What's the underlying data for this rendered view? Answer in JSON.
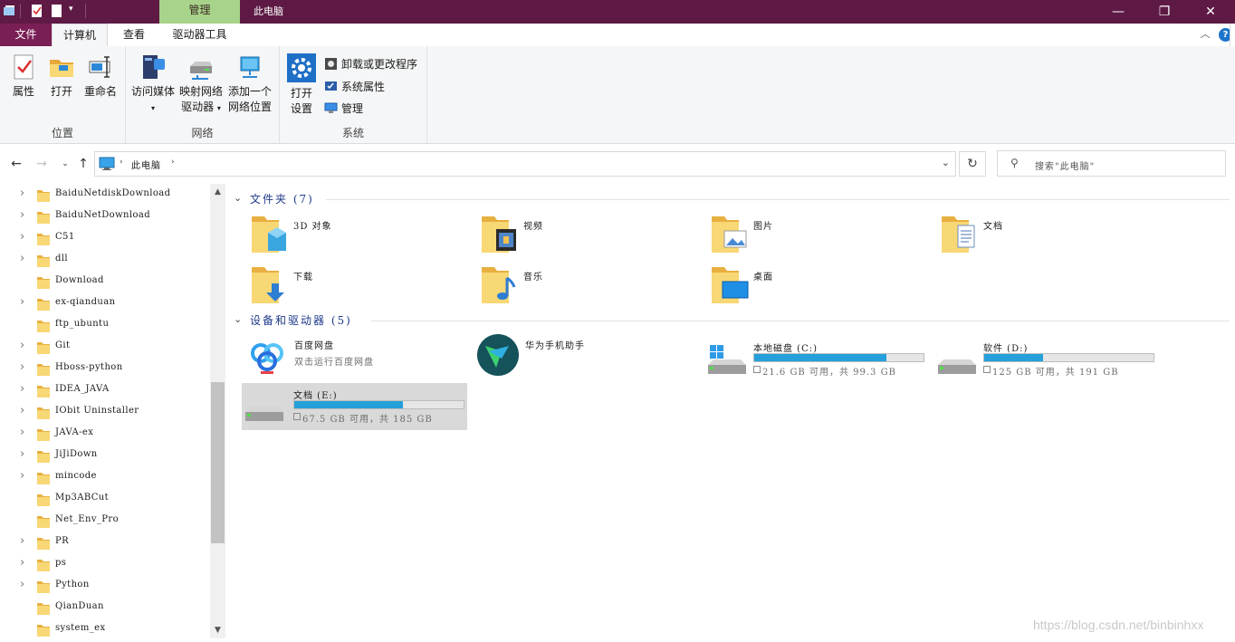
{
  "window": {
    "title": "此电脑",
    "context_tab": "管理",
    "controls": [
      "—",
      "❐",
      "✕"
    ]
  },
  "ribbon_tabs": {
    "file": "文件",
    "computer": "计算机",
    "view": "查看",
    "drive_tools": "驱动器工具"
  },
  "ribbon": {
    "location": {
      "label": "位置",
      "properties": "属性",
      "open": "打开",
      "rename": "重命名"
    },
    "network": {
      "label": "网络",
      "access_media": "访问媒体",
      "map_drive_l1": "映射网络",
      "map_drive_l2": "驱动器",
      "add_location_l1": "添加一个",
      "add_location_l2": "网络位置"
    },
    "system": {
      "label": "系统",
      "open_settings_l1": "打开",
      "open_settings_l2": "设置",
      "uninstall": "卸载或更改程序",
      "system_properties": "系统属性",
      "manage": "管理"
    }
  },
  "address": {
    "crumb": "此电脑",
    "search_placeholder": "搜索\"此电脑\""
  },
  "nav_tree": [
    {
      "label": "BaiduNetdiskDownload",
      "expandable": true
    },
    {
      "label": "BaiduNetDownload",
      "expandable": true
    },
    {
      "label": "C51",
      "expandable": true
    },
    {
      "label": "dll",
      "expandable": true
    },
    {
      "label": "Download",
      "expandable": false
    },
    {
      "label": "ex-qianduan",
      "expandable": true
    },
    {
      "label": "ftp_ubuntu",
      "expandable": false
    },
    {
      "label": "Git",
      "expandable": true
    },
    {
      "label": "Hboss-python",
      "expandable": true
    },
    {
      "label": "IDEA_JAVA",
      "expandable": true
    },
    {
      "label": "IObit Uninstaller",
      "expandable": true
    },
    {
      "label": "JAVA-ex",
      "expandable": true
    },
    {
      "label": "JiJiDown",
      "expandable": true
    },
    {
      "label": "mincode",
      "expandable": true
    },
    {
      "label": "Mp3ABCut",
      "expandable": false
    },
    {
      "label": "Net_Env_Pro",
      "expandable": false
    },
    {
      "label": "PR",
      "expandable": true
    },
    {
      "label": "ps",
      "expandable": true
    },
    {
      "label": "Python",
      "expandable": true
    },
    {
      "label": "QianDuan",
      "expandable": false
    },
    {
      "label": "system_ex",
      "expandable": false
    }
  ],
  "folders_section": {
    "title": "文件夹 (7)",
    "items": [
      {
        "label": "3D 对象",
        "icon": "3d-objects-folder-icon"
      },
      {
        "label": "视频",
        "icon": "videos-folder-icon"
      },
      {
        "label": "图片",
        "icon": "pictures-folder-icon"
      },
      {
        "label": "文档",
        "icon": "documents-folder-icon"
      },
      {
        "label": "下载",
        "icon": "downloads-folder-icon"
      },
      {
        "label": "音乐",
        "icon": "music-folder-icon"
      },
      {
        "label": "桌面",
        "icon": "desktop-folder-icon"
      }
    ]
  },
  "devices_section": {
    "title": "设备和驱动器 (5)",
    "baidu": {
      "name": "百度网盘",
      "sub": "双击运行百度网盘"
    },
    "huawei": {
      "name": "华为手机助手"
    },
    "drives": [
      {
        "name": "本地磁盘 (C:)",
        "free": "21.6 GB 可用，共 99.3 GB",
        "used_fraction": 0.78
      },
      {
        "name": "软件 (D:)",
        "free": "125 GB 可用，共 191 GB",
        "used_fraction": 0.35
      },
      {
        "name": "文档 (E:)",
        "free": "67.5 GB 可用，共 185 GB",
        "used_fraction": 0.64,
        "selected": true
      }
    ]
  },
  "watermark": "https://blog.csdn.net/binbinhxx",
  "colors": {
    "title_bar": "#5e1a45",
    "context_tab": "#a7d38b",
    "drive_bar": "#26a0da",
    "selection": "#d9d9d9"
  }
}
